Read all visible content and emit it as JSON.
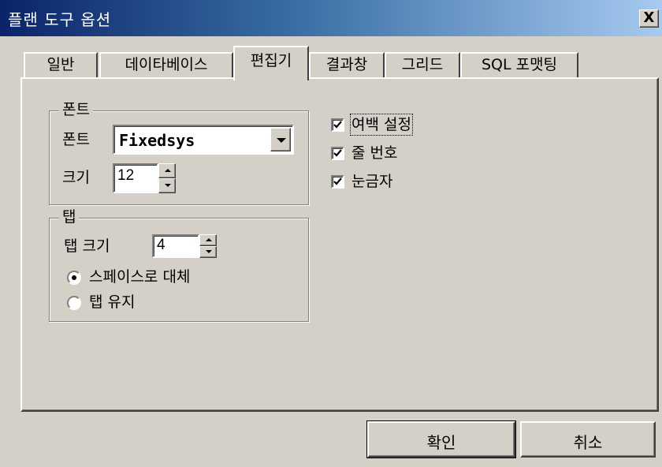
{
  "window": {
    "title": "플랜 도구 옵션",
    "close_label": "X"
  },
  "tabs": [
    {
      "label": "일반",
      "active": false
    },
    {
      "label": "데이타베이스",
      "active": false
    },
    {
      "label": "편집기",
      "active": true
    },
    {
      "label": "결과창",
      "active": false
    },
    {
      "label": "그리드",
      "active": false
    },
    {
      "label": "SQL 포맷팅",
      "active": false
    }
  ],
  "font_group": {
    "legend": "폰트",
    "font_label": "폰트",
    "font_value": "Fixedsys",
    "size_label": "크기",
    "size_value": "12"
  },
  "tab_group": {
    "legend": "탭",
    "size_label": "탭 크기",
    "size_value": "4",
    "options": [
      {
        "label": "스페이스로 대체",
        "selected": true
      },
      {
        "label": "탭 유지",
        "selected": false
      }
    ]
  },
  "checkboxes": [
    {
      "label": "여백 설정",
      "checked": true
    },
    {
      "label": "줄 번호",
      "checked": true
    },
    {
      "label": "눈금자",
      "checked": true
    }
  ],
  "buttons": {
    "ok": "확인",
    "cancel": "취소"
  },
  "colors": {
    "face": "#d4d0c8",
    "title_start": "#0a246a",
    "title_end": "#a6caf0"
  }
}
